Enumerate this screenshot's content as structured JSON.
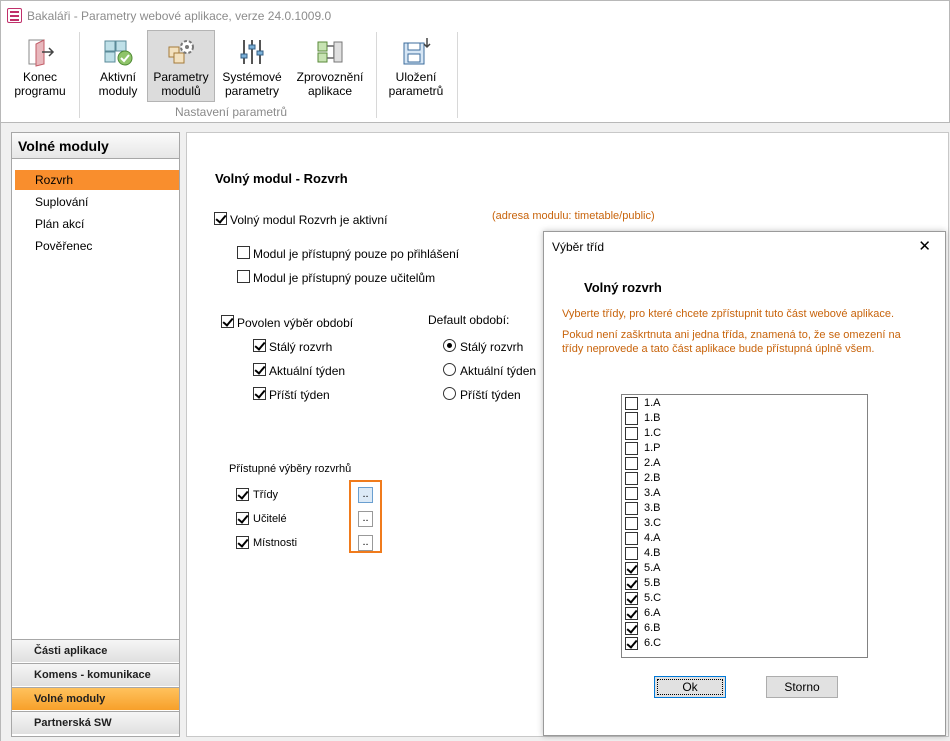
{
  "window": {
    "title": "Bakaláři - Parametry webové aplikace, verze 24.0.1009.0"
  },
  "ribbon": {
    "buttons": [
      {
        "line1": "Konec",
        "line2": "programu",
        "icon": "exit-door-icon"
      },
      {
        "line1": "Aktivní",
        "line2": "moduly",
        "icon": "modules-icon"
      },
      {
        "line1": "Parametry",
        "line2": "modulů",
        "icon": "module-parameters-icon"
      },
      {
        "line1": "Systémové",
        "line2": "parametry",
        "icon": "sliders-icon"
      },
      {
        "line1": "Zprovoznění",
        "line2": "aplikace",
        "icon": "app-setup-icon"
      },
      {
        "line1": "Uložení",
        "line2": "parametrů",
        "icon": "save-parameters-icon"
      }
    ],
    "group_label": "Nastavení parametrů"
  },
  "sidebar": {
    "header": "Volné moduly",
    "items": [
      "Rozvrh",
      "Suplování",
      "Plán akcí",
      "Pověřenec"
    ],
    "selected": "Rozvrh",
    "bottom": [
      "Části aplikace",
      "Komens - komunikace",
      "Volné moduly",
      "Partnerská SW"
    ],
    "bottom_selected": "Volné moduly"
  },
  "main": {
    "title": "Volný modul - Rozvrh",
    "active_label": "Volný modul Rozvrh je aktivní",
    "module_address": "(adresa modulu: timetable/public)",
    "login_only_label": "Modul je přístupný pouze po přihlášení",
    "teachers_only_label": "Modul je přístupný pouze učitelům",
    "period_select_label": "Povolen výběr období",
    "periods": [
      "Stálý rozvrh",
      "Aktuální týden",
      "Příští týden"
    ],
    "default_period_label": "Default období:",
    "default_periods": [
      "Stálý rozvrh",
      "Aktuální týden",
      "Příští týden"
    ],
    "default_selected": "Stálý rozvrh",
    "access_title": "Přístupné výběry rozvrhů",
    "access_items": [
      "Třídy",
      "Učitelé",
      "Místnosti"
    ],
    "dots_label": ".."
  },
  "dialog": {
    "title": "Výběr tříd",
    "close": "✕",
    "heading": "Volný rozvrh",
    "info1": "Vyberte třídy, pro které chcete zpřístupnit tuto část webové aplikace.",
    "info2a": "Pokud není zaškrtnuta ani jedna třída, znamená to, že se omezení na",
    "info2b": "třídy neprovede a tato část aplikace bude přístupná úplně všem.",
    "classes": [
      "1.A",
      "1.B",
      "1.C",
      "1.P",
      "2.A",
      "2.B",
      "3.A",
      "3.B",
      "3.C",
      "4.A",
      "4.B",
      "5.A",
      "5.B",
      "5.C",
      "6.A",
      "6.B",
      "6.C"
    ],
    "checked": [
      "5.A",
      "5.B",
      "5.C",
      "6.A",
      "6.B",
      "6.C"
    ],
    "ok": "Ok",
    "cancel": "Storno"
  }
}
